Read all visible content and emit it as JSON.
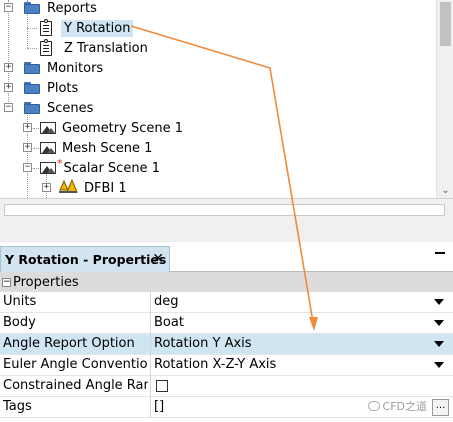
{
  "tree": {
    "items": {
      "reports": "Reports",
      "y_rotation": "Y Rotation",
      "z_translation": "Z Translation",
      "monitors": "Monitors",
      "plots": "Plots",
      "scenes": "Scenes",
      "geometry_scene": "Geometry Scene 1",
      "mesh_scene": "Mesh Scene 1",
      "scalar_scene": "Scalar Scene 1",
      "dfbi": "DFBI 1"
    },
    "modified_marker": "*"
  },
  "properties_panel": {
    "tab_title": "Y Rotation - Properties",
    "close_glyph": "✕",
    "category": "Properties",
    "rows": [
      {
        "name": "Units",
        "value": "deg"
      },
      {
        "name": "Body",
        "value": "Boat"
      },
      {
        "name": "Angle Report Option",
        "value": "Rotation Y Axis"
      },
      {
        "name": "Euler Angle Convention",
        "value": "Rotation X-Z-Y Axis"
      },
      {
        "name": "Constrained Angle Rang",
        "value": ""
      },
      {
        "name": "Tags",
        "value": "[]"
      }
    ],
    "highlighted_row": "Angle Report Option",
    "constrained_checked": false,
    "ellipsis": "..."
  },
  "annotation_color": "#f08a3c",
  "selection_color": "#cfe5f2",
  "watermark": "CFD之道"
}
